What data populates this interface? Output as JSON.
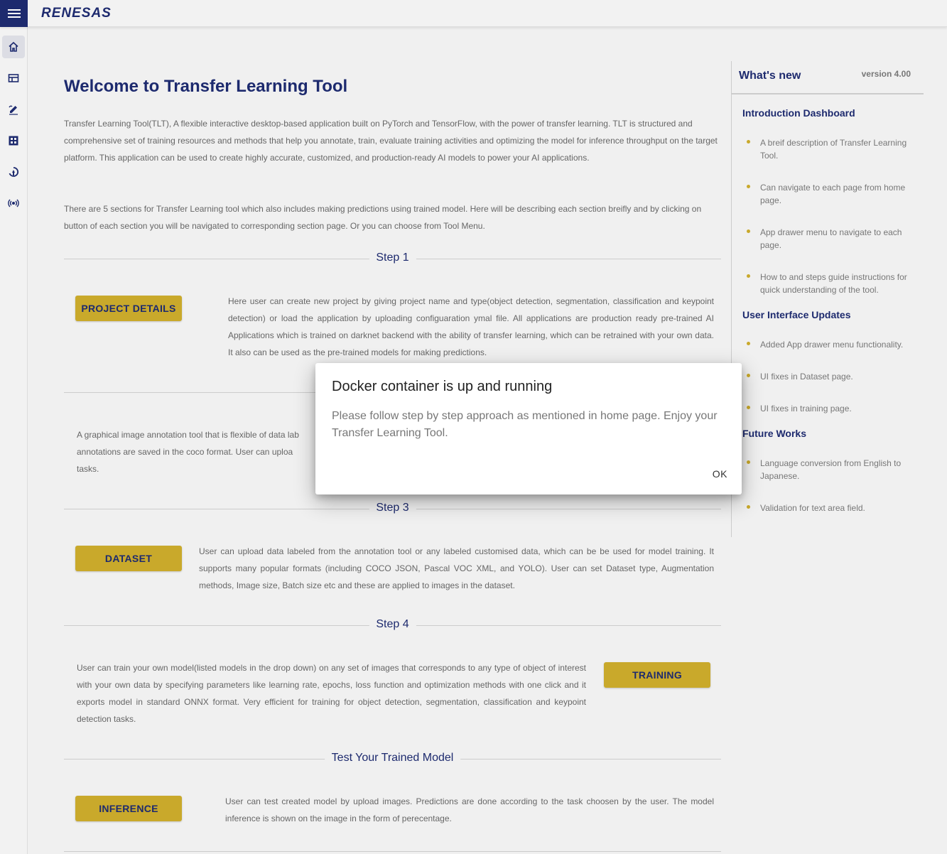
{
  "header": {
    "menu_icon": "hamburger-icon",
    "logo": "RENESAS"
  },
  "sidebar": {
    "items": [
      {
        "icon": "home-icon",
        "active": true
      },
      {
        "icon": "table-icon"
      },
      {
        "icon": "annotate-icon"
      },
      {
        "icon": "dashboard-icon"
      },
      {
        "icon": "training-icon"
      },
      {
        "icon": "inference-icon"
      }
    ]
  },
  "main": {
    "title": "Welcome to Transfer Learning Tool",
    "intro": "Transfer Learning Tool(TLT), A flexible interactive desktop-based application built on PyTorch and TensorFlow, with the power of transfer learning. TLT is structured and comprehensive set of training resources and methods that help you annotate, train, evaluate training activities and optimizing the model for inference throughput on the target platform. This application can be used to create highly accurate, customized, and production-ready AI models to power your AI applications.",
    "sections_text": "There are 5 sections for Transfer Learning tool which also includes making predictions using trained model. Here will be describing each section breifly and by clicking on button of each section you will be navigated to corresponding section page. Or you can choose from Tool Menu.",
    "step1": {
      "label": "Step 1",
      "button": "PROJECT DETAILS",
      "text": "Here user can create new project by giving project name and type(object detection, segmentation, classification and keypoint detection) or load the application by uploading configuaration ymal file. All applications are production ready pre-trained AI Applications which is trained on darknet backend with the ability of transfer learning, which can be retrained with your own data. It also can be used as the pre-trained models for making predictions."
    },
    "step2": {
      "text_visible": "A graphical image annotation tool that is flexible of data lab",
      "text_line2": "annotations are saved in the coco format. User can uploa",
      "text_line3": "tasks."
    },
    "step3": {
      "label": "Step 3",
      "button": "DATASET",
      "text": "User can upload data labeled from the annotation tool or any labeled customised data, which can be be used for model training. It supports many popular formats (including COCO JSON, Pascal VOC XML, and YOLO). User can set Dataset type, Augmentation methods, Image size, Batch size etc and these are applied to images in the dataset."
    },
    "step4": {
      "label": "Step 4",
      "button": "TRAINING",
      "text": "User can train your own model(listed models in the drop down) on any set of images that corresponds to any type of object of interest with your own data by specifying parameters like learning rate, epochs, loss function and optimization methods with one click and it exports model in standard ONNX format. Very efficient for training for object detection, segmentation, classification and keypoint detection tasks."
    },
    "inference": {
      "label": "Test Your Trained Model",
      "button": "INFERENCE",
      "text": "User can test created model by upload images. Predictions are done according to the task choosen by the user. The model inference is shown on the image in the form of perecentage."
    }
  },
  "whats_new": {
    "title": "What's new",
    "version": "version 4.00",
    "sections": [
      {
        "title": "Introduction Dashboard",
        "items": [
          "A breif description of Transfer Learning Tool.",
          "Can navigate to each page from home page.",
          "App drawer menu to navigate to each page.",
          "How to and steps guide instructions for quick understanding of the tool."
        ]
      },
      {
        "title": "User Interface Updates",
        "items": [
          "Added App drawer menu functionality.",
          "UI fixes in Dataset page.",
          "UI fixes in training page."
        ]
      },
      {
        "title": "Future Works",
        "items": [
          "Language conversion from English to Japanese.",
          "Validation for text area field."
        ]
      }
    ]
  },
  "dialog": {
    "title": "Docker container is up and running",
    "body": "Please follow step by step approach as mentioned in home page. Enjoy your Transfer Learning Tool.",
    "ok_label": "OK"
  },
  "colors": {
    "brand_navy": "#1d2a6e",
    "gold": "#c9a92b",
    "background": "#f0f0f0"
  }
}
